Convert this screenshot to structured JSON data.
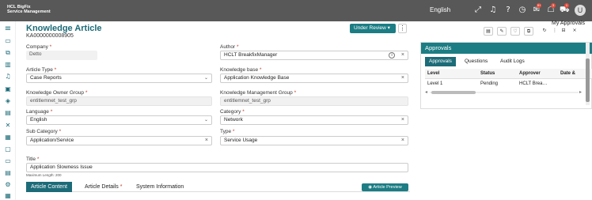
{
  "topbar": {
    "brand_line1": "HCL BigFix",
    "brand_line2": "Service Management",
    "language": "English",
    "icons": [
      "expand-icon",
      "bell-icon",
      "help-icon",
      "history-icon",
      "inbox-icon",
      "notifications-icon",
      "cart-icon"
    ],
    "badges": {
      "inbox": "9+",
      "notifications": "3",
      "cart": "1"
    },
    "avatar_letter": "U"
  },
  "tooltip": "My Approvals",
  "sidebar": {
    "icons": [
      "menu-icon",
      "monitor-icon",
      "copy-icon",
      "chart-icon",
      "bell-icon",
      "box-icon",
      "cube-icon",
      "document-icon",
      "tools-icon",
      "grid-icon",
      "layers-icon",
      "server-icon",
      "database-icon",
      "settings-icon",
      "calendar-icon"
    ]
  },
  "article": {
    "title": "Knowledge Article",
    "number": "KA0000000008905",
    "status": "Under Review",
    "status_chevron": "▾",
    "more": "⋮"
  },
  "form": {
    "company_label": "Company",
    "company_value": "Detto",
    "author_label": "Author",
    "author_value": "HCLT BreakfixManager",
    "article_type_label": "Article Type",
    "article_type_value": "Case Reports",
    "kb_label": "Knowledge base",
    "kb_value": "Application Knowledge Base",
    "owner_group_label": "Knowledge Owner Group",
    "owner_group_value": "entitlemnet_test_grp",
    "mgmt_group_label": "Knowledge Management Group",
    "mgmt_group_value": "entitlemnet_test_grp",
    "language_label": "Language",
    "language_value": "English",
    "category_label": "Category",
    "category_value": "Network",
    "subcategory_label": "Sub Category",
    "subcategory_value": "Application/Service",
    "type_label": "Type",
    "type_value": "Service Usage",
    "title_label": "Title",
    "title_value": "Application Slowness Issue",
    "max_length": "Maximum Length: 200",
    "required_mark": "*",
    "clear_glyph": "×",
    "dropdown_glyph": "⌄",
    "info_glyph": "i"
  },
  "content_tabs": {
    "article_content": "Article Content",
    "article_details": "Article Details",
    "system_information": "System Information",
    "preview": "Article Preview",
    "preview_icon": "◉"
  },
  "action_icons": {
    "print": "▤",
    "attach": "✎",
    "thumbs_up": "♡",
    "copy": "⧉",
    "refresh": "↻",
    "more": "⋮",
    "approvals": "⊟",
    "close": "×"
  },
  "approvals": {
    "header": "Approvals",
    "tabs": [
      "Approvals",
      "Questions",
      "Audit Logs"
    ],
    "columns": [
      "Level",
      "Status",
      "Approver",
      "Date &"
    ],
    "rows": [
      [
        "Level 1",
        "Pending",
        "HCLT Brea…",
        ""
      ]
    ],
    "scroll_left": "◂",
    "scroll_right": "▸"
  },
  "colors": {
    "accent": "#1c6b78",
    "topbar": "#585858",
    "badge": "#e74c3c"
  }
}
